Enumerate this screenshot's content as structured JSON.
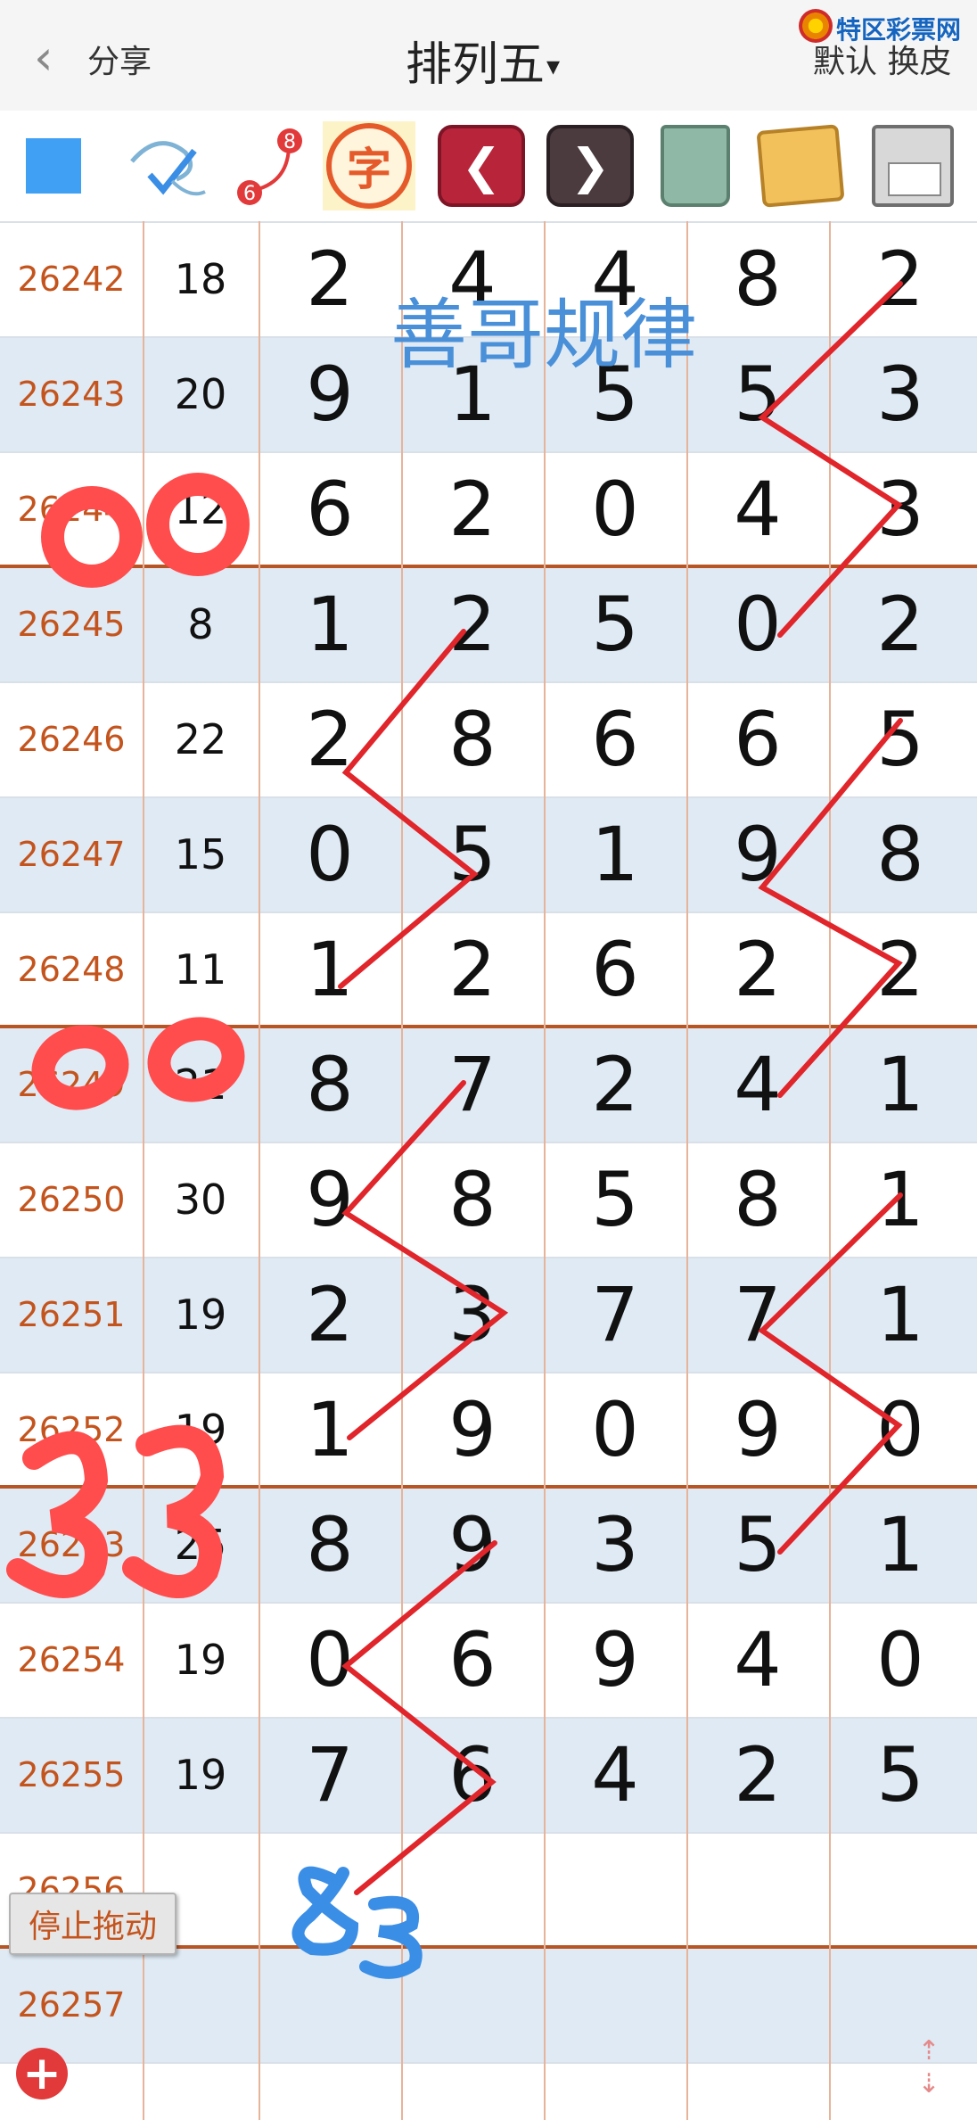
{
  "header": {
    "back_label": "分享",
    "title": "排列五",
    "title_caret": "▾",
    "brand": "特区彩票网",
    "skin_label": "默认 换皮"
  },
  "toolbar": {
    "tools": [
      "color-swatch",
      "pen-tool",
      "number-curve",
      "text-tool",
      "undo",
      "redo",
      "trash",
      "album",
      "save"
    ],
    "word_label": "字",
    "curve_a": "8",
    "curve_b": "6",
    "left_arrow": "❮",
    "right_arrow": "❯"
  },
  "watermark": "善哥规律",
  "rows": [
    {
      "issue": "26242",
      "sum": "18",
      "d": [
        "2",
        "4",
        "4",
        "8",
        "2"
      ]
    },
    {
      "issue": "26243",
      "sum": "20",
      "d": [
        "9",
        "1",
        "5",
        "5",
        "3"
      ]
    },
    {
      "issue": "26244",
      "sum": "12",
      "d": [
        "6",
        "2",
        "0",
        "4",
        "3"
      ]
    },
    {
      "issue": "26245",
      "sum": "8",
      "d": [
        "1",
        "2",
        "5",
        "0",
        "2"
      ]
    },
    {
      "issue": "26246",
      "sum": "22",
      "d": [
        "2",
        "8",
        "6",
        "6",
        "5"
      ]
    },
    {
      "issue": "26247",
      "sum": "15",
      "d": [
        "0",
        "5",
        "1",
        "9",
        "8"
      ]
    },
    {
      "issue": "26248",
      "sum": "11",
      "d": [
        "1",
        "2",
        "6",
        "2",
        "2"
      ]
    },
    {
      "issue": "26249",
      "sum": "21",
      "d": [
        "8",
        "7",
        "2",
        "4",
        "1"
      ]
    },
    {
      "issue": "26250",
      "sum": "30",
      "d": [
        "9",
        "8",
        "5",
        "8",
        "1"
      ]
    },
    {
      "issue": "26251",
      "sum": "19",
      "d": [
        "2",
        "3",
        "7",
        "7",
        "1"
      ]
    },
    {
      "issue": "26252",
      "sum": "19",
      "d": [
        "1",
        "9",
        "0",
        "9",
        "0"
      ]
    },
    {
      "issue": "26253",
      "sum": "25",
      "d": [
        "8",
        "9",
        "3",
        "5",
        "1"
      ]
    },
    {
      "issue": "26254",
      "sum": "19",
      "d": [
        "0",
        "6",
        "9",
        "4",
        "0"
      ]
    },
    {
      "issue": "26255",
      "sum": "19",
      "d": [
        "7",
        "6",
        "4",
        "2",
        "5"
      ]
    },
    {
      "issue": "26256",
      "sum": "",
      "d": [
        "",
        "",
        "",
        "",
        ""
      ]
    },
    {
      "issue": "26257",
      "sum": "",
      "d": [
        "",
        "",
        "",
        "",
        ""
      ]
    }
  ],
  "annotations": {
    "mark_1": "00",
    "mark_2": "00",
    "mark_3": "33",
    "mark_4": "83",
    "mark_color": "#ff4d4d",
    "blue_color": "#3b8ee6"
  },
  "controls": {
    "stop_drag": "停止拖动",
    "add_symbol": "+",
    "scroll_up": "⇡",
    "scroll_down": "⇣"
  }
}
